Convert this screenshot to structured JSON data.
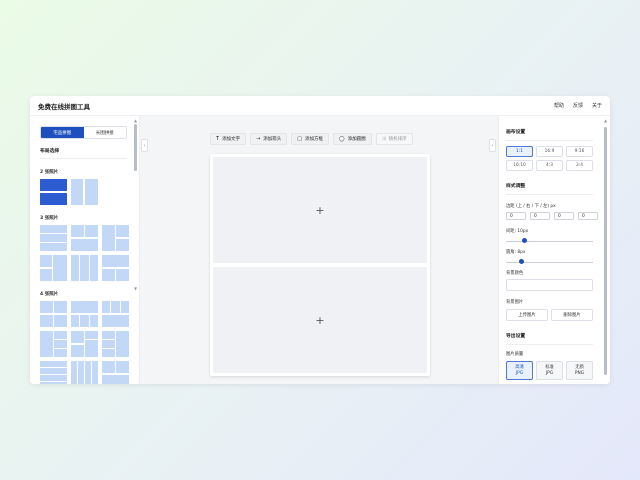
{
  "header": {
    "title": "免费在线拼图工具",
    "nav": [
      "帮助",
      "反馈",
      "关于"
    ]
  },
  "left_panel": {
    "tabs": {
      "active": "宅品拼图",
      "inactive": "长图拼接"
    },
    "section_title": "布局选择",
    "groups": [
      {
        "title": "2 张照片"
      },
      {
        "title": "3 张照片"
      },
      {
        "title": "4 张照片"
      }
    ]
  },
  "toolbar": {
    "buttons": [
      {
        "icon": "text-icon",
        "glyph": "T",
        "label": "添加文字"
      },
      {
        "icon": "arrow-icon",
        "glyph": "→",
        "label": "添加箭头"
      },
      {
        "icon": "square-icon",
        "glyph": "□",
        "label": "添加方框"
      },
      {
        "icon": "ellipse-icon",
        "glyph": "◯",
        "label": "添加圆圈"
      },
      {
        "icon": "shuffle-icon",
        "glyph": "⤨",
        "label": "随机排序"
      }
    ]
  },
  "canvas": {
    "cells": [
      {
        "placeholder": "+"
      },
      {
        "placeholder": "+"
      }
    ]
  },
  "right_panel": {
    "canvas_settings_title": "画布设置",
    "ratios": [
      "1:1",
      "16:9",
      "9:16",
      "16:10",
      "4:3",
      "3:4"
    ],
    "selected_ratio": "1:1",
    "style_title": "样式调整",
    "padding_label": "边距 (上 / 右 / 下 / 左) px",
    "padding_values": [
      "0",
      "0",
      "0",
      "0"
    ],
    "gap_label": "间距: 10px",
    "gap_value": 10,
    "radius_label": "圆角: 8px",
    "radius_value": 8,
    "bg_color_label": "背景颜色",
    "bg_image_label": "背景图片",
    "bg_upload": "上传图片",
    "bg_remove": "删除图片",
    "export_title": "导出设置",
    "quality_label": "图片质量",
    "qualities": [
      {
        "name": "高清",
        "format": "JPG"
      },
      {
        "name": "标准",
        "format": "JPG"
      },
      {
        "name": "无损",
        "format": "PNG"
      }
    ],
    "selected_quality": "高清"
  },
  "colors": {
    "accent": "#1d4fbf",
    "tile": "#c3d8f6"
  }
}
